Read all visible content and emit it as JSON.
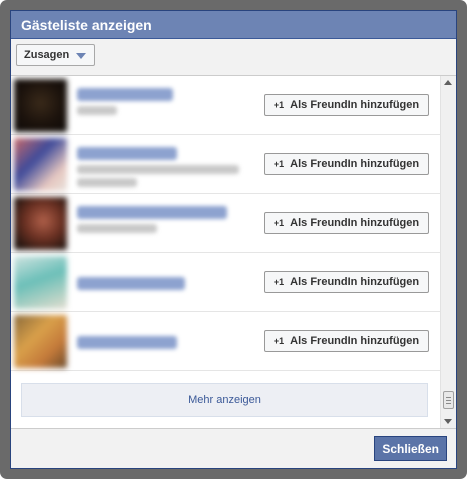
{
  "dialog": {
    "title": "Gästeliste anzeigen",
    "filter": {
      "selected": "Zusagen"
    },
    "guests": [
      {
        "add_label": "Als FreundIn hinzufügen",
        "plus_icon": "+1"
      },
      {
        "add_label": "Als FreundIn hinzufügen",
        "plus_icon": "+1"
      },
      {
        "add_label": "Als FreundIn hinzufügen",
        "plus_icon": "+1"
      },
      {
        "add_label": "Als FreundIn hinzufügen",
        "plus_icon": "+1"
      },
      {
        "add_label": "Als FreundIn hinzufügen",
        "plus_icon": "+1"
      }
    ],
    "more_label": "Mehr anzeigen",
    "close_label": "Schließen"
  }
}
